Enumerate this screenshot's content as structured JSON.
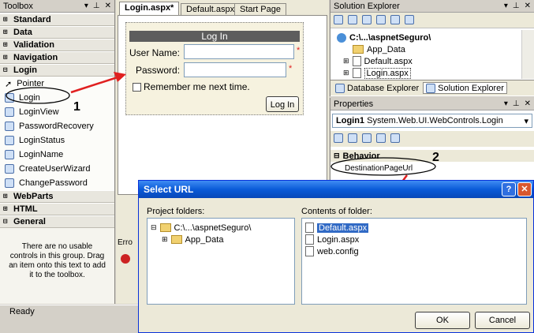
{
  "toolbox": {
    "title": "Toolbox",
    "groups_top": [
      "Standard",
      "Data",
      "Validation",
      "Navigation"
    ],
    "login_group": "Login",
    "items": [
      "Pointer",
      "Login",
      "LoginView",
      "PasswordRecovery",
      "LoginStatus",
      "LoginName",
      "CreateUserWizard",
      "ChangePassword"
    ],
    "groups_bottom": [
      "WebParts",
      "HTML",
      "General"
    ],
    "empty_text": "There are no usable controls in this group. Drag an item onto this text to add it to the toolbox."
  },
  "editor": {
    "tabs": [
      "Login.aspx*",
      "Default.aspx",
      "Start Page"
    ],
    "login": {
      "header": "Log In",
      "user_label": "User Name:",
      "password_label": "Password:",
      "remember_label": "Remember me next time.",
      "button": "Log In",
      "required_mark": "*"
    },
    "error_tab": "Erro"
  },
  "solution_explorer": {
    "title": "Solution Explorer",
    "root": "C:\\...\\aspnetSeguro\\",
    "items": [
      "App_Data",
      "Default.aspx",
      "Login.aspx"
    ],
    "tabs": [
      "Database Explorer",
      "Solution Explorer"
    ]
  },
  "properties": {
    "title": "Properties",
    "object": "Login1",
    "object_type": "System.Web.UI.WebControls.Login",
    "category": "Behavior",
    "property": "DestinationPageUrl"
  },
  "dialog": {
    "title": "Select URL",
    "project_label": "Project folders:",
    "contents_label": "Contents of folder:",
    "tree_root": "C:\\...\\aspnetSeguro\\",
    "tree_child": "App_Data",
    "files": [
      "Default.aspx",
      "Login.aspx",
      "web.config"
    ],
    "ok": "OK",
    "cancel": "Cancel"
  },
  "annotations": {
    "step1": "1",
    "step2": "2"
  },
  "status": {
    "text": "Ready"
  },
  "colors": {
    "dialog_title": "#3169c6",
    "selection": "#316ac5",
    "annotation": "#e02020"
  }
}
